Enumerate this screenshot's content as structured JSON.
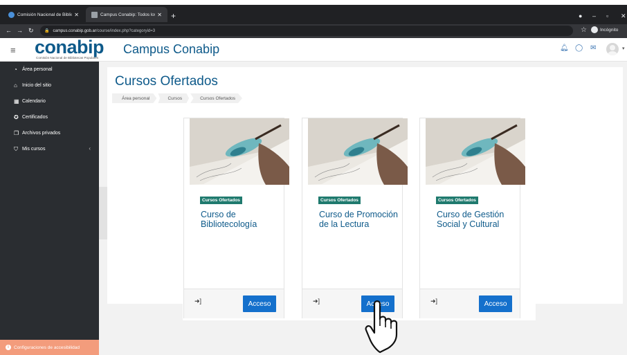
{
  "browser": {
    "tabs": [
      {
        "title": "Comisión Nacional de Biblioteca",
        "favicon_color": "#4a90d9",
        "active": false
      },
      {
        "title": "Campus Conabip: Todos los curs",
        "favicon_color": "#9aa0a6",
        "active": true
      }
    ],
    "new_tab_label": "+",
    "address": {
      "host": "campus.conabip.gob.ar",
      "path": "/course/index.php?categoryid=3"
    },
    "profile_label": "Incógnito"
  },
  "header": {
    "logo_text": "conabip",
    "logo_subtitle": "Comisión Nacional de Bibliotecas Populares",
    "site_title": "Campus Conabip"
  },
  "sidebar": {
    "items": [
      {
        "label": "Área personal",
        "icon": "dashboard-icon"
      },
      {
        "label": "Inicio del sitio",
        "icon": "home-icon"
      },
      {
        "label": "Calendario",
        "icon": "calendar-icon"
      },
      {
        "label": "Certificados",
        "icon": "certificate-icon"
      },
      {
        "label": "Archivos privados",
        "icon": "files-icon"
      },
      {
        "label": "Mis cursos",
        "icon": "graduation-cap-icon"
      }
    ],
    "accessibility_label": "Configuraciones de accesibilidad"
  },
  "main": {
    "page_title": "Cursos Ofertados",
    "breadcrumb": [
      "Área personal",
      "Cursos",
      "Cursos Ofertados"
    ],
    "courses": [
      {
        "category": "Cursos Ofertados",
        "name": "Curso de Bibliotecología",
        "button": "Acceso"
      },
      {
        "category": "Cursos Ofertados",
        "name": "Curso de Promoción de la Lectura",
        "button": "Acceso"
      },
      {
        "category": "Cursos Ofertados",
        "name": "Curso de Gestión Social y Cultural",
        "button": "Acceso"
      }
    ]
  },
  "colors": {
    "brand": "#0e5a8a",
    "sidebar_bg": "#2a2d31",
    "badge": "#1f7a6e",
    "button": "#1470cc",
    "accessibility_bar": "#f39c7c"
  }
}
